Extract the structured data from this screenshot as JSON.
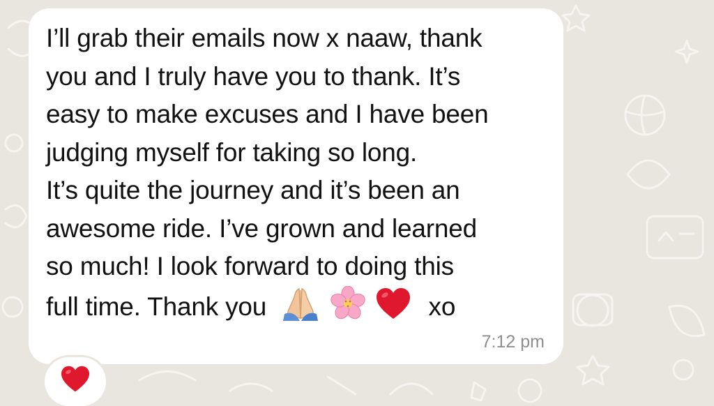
{
  "message": {
    "lines": [
      "I’ll grab their emails now x naaw, thank",
      "you and I truly have you to thank. It’s",
      "easy to make excuses and I have been",
      "judging myself for taking so long.",
      "It’s quite the journey and it’s been an",
      "awesome ride. I’ve grown and learned",
      "so much! I look forward to doing this"
    ],
    "last_line_text": "full time. Thank you",
    "emojis": [
      "folded-hands-icon",
      "cherry-blossom-icon",
      "red-heart-icon"
    ],
    "last_line_suffix": "xo",
    "time": "7:12 pm"
  },
  "reaction": {
    "emoji": "red-heart-icon"
  },
  "colors": {
    "wallpaper": "#e9e5df",
    "bubble": "#ffffff",
    "heart": "#e0182d",
    "timestamp": "#8e8e8e"
  }
}
